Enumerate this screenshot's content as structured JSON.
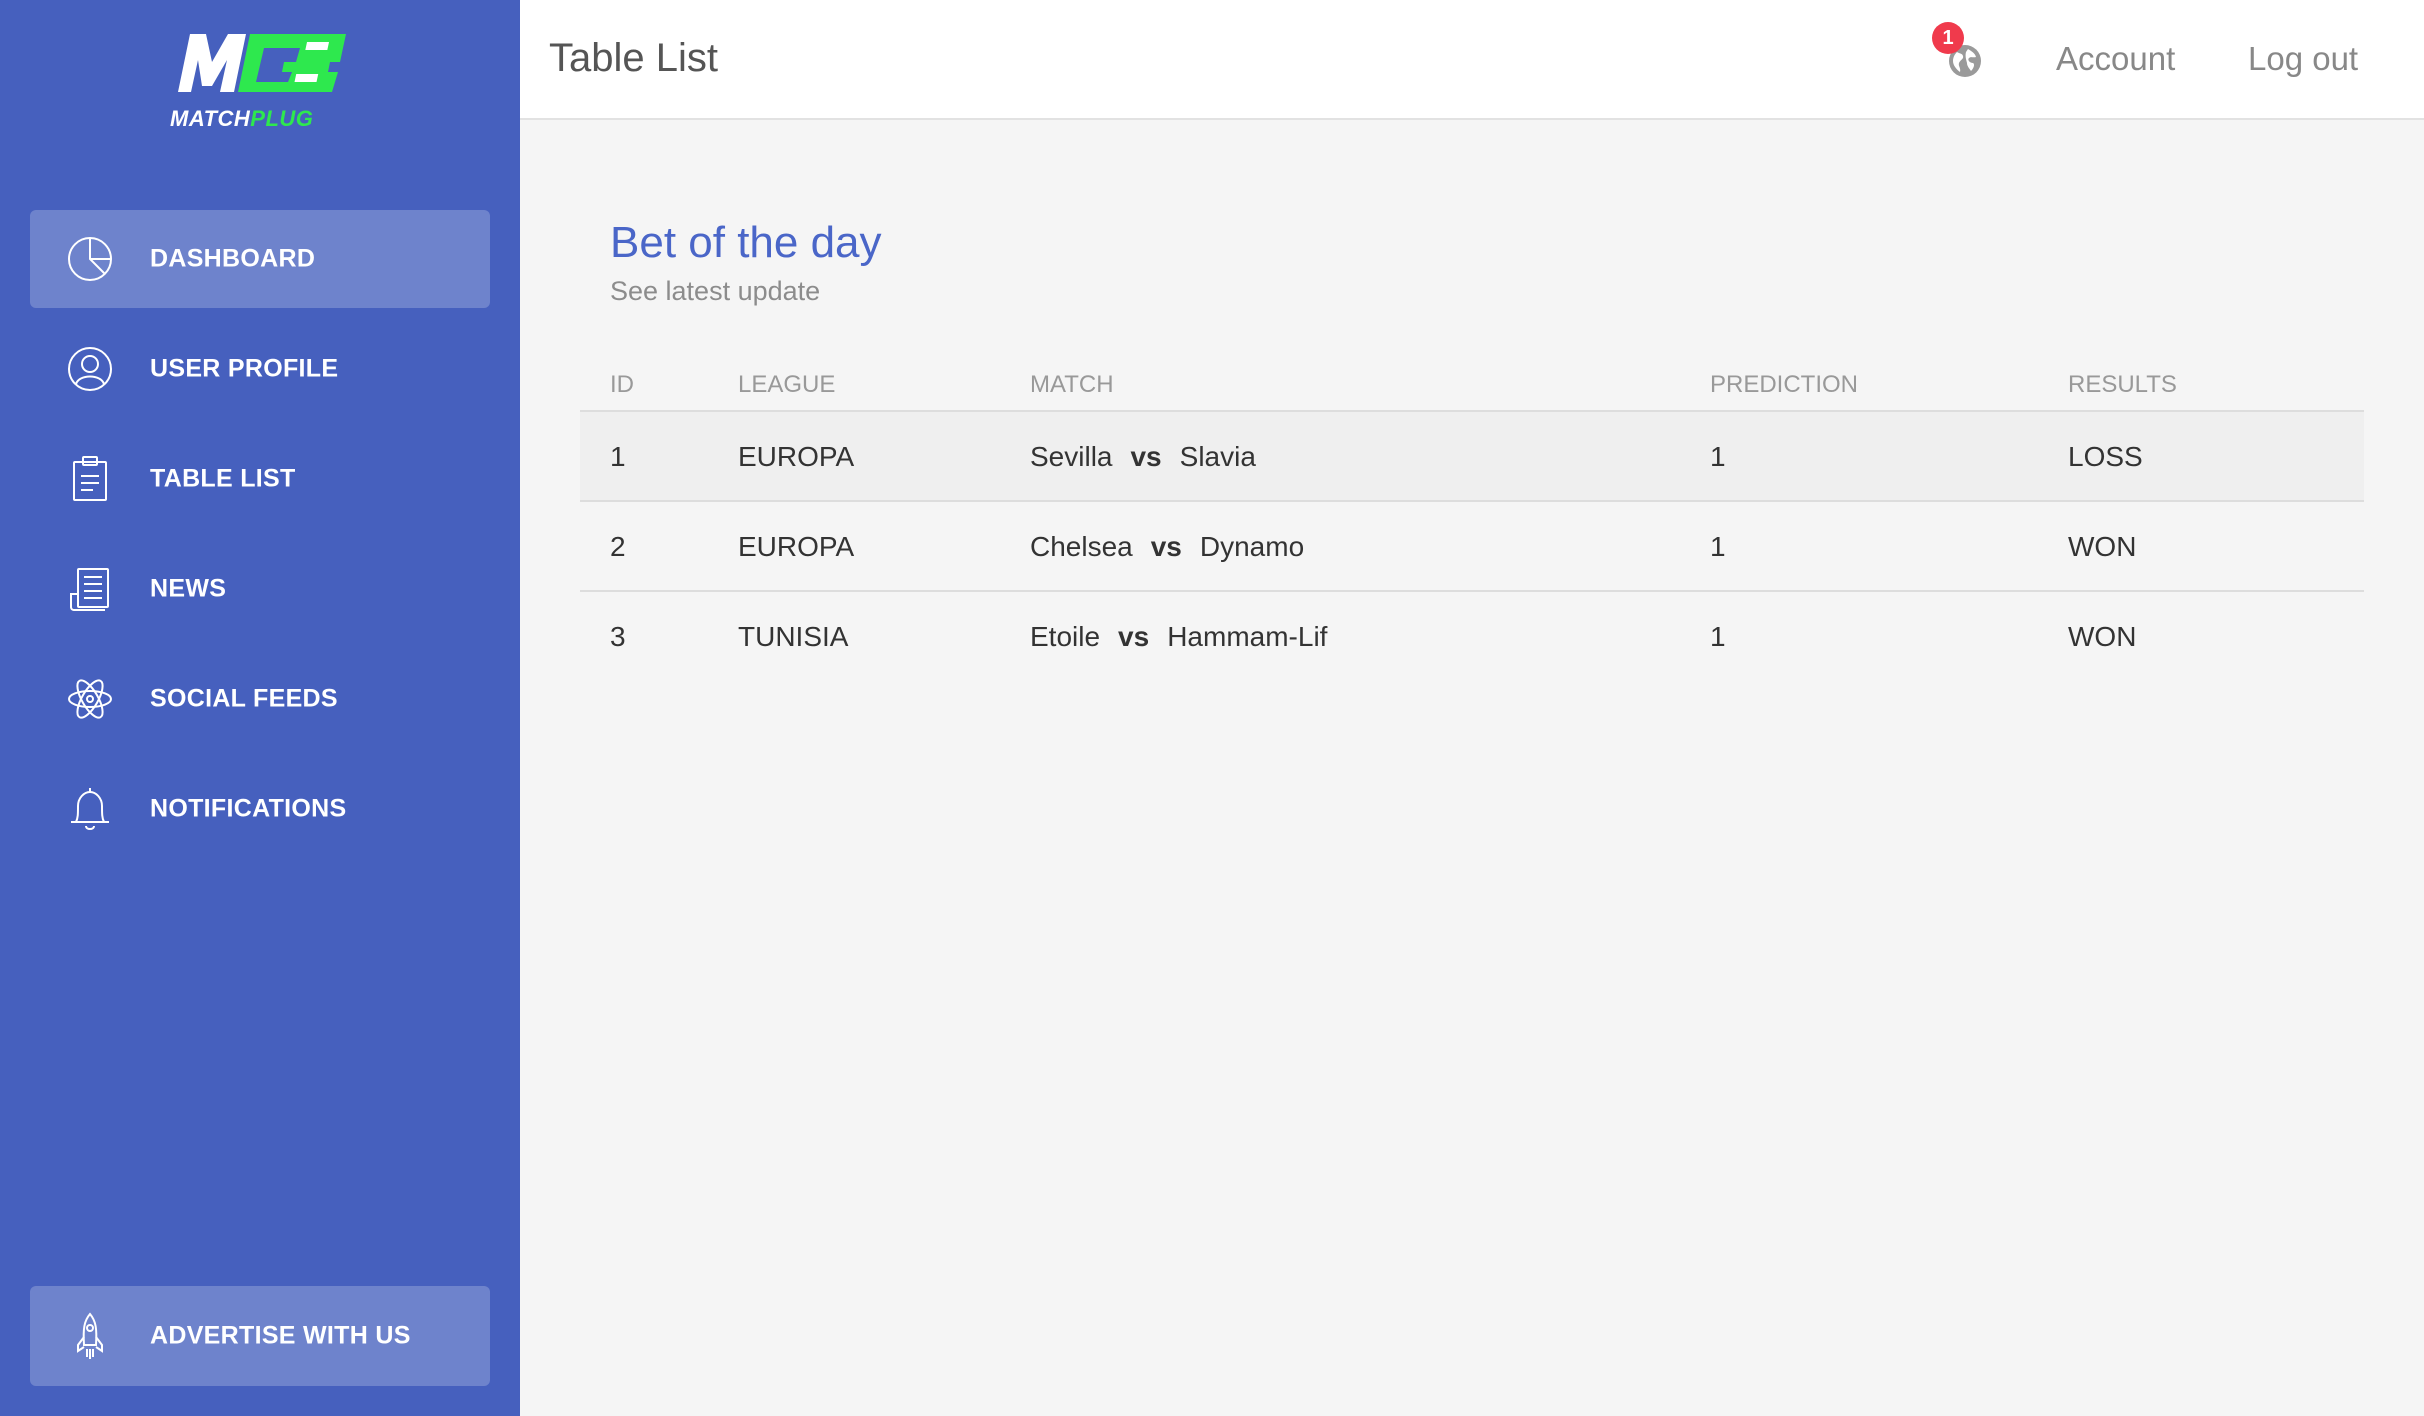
{
  "brand": {
    "mark": "M",
    "name_part1": "MATCH",
    "name_part2": "PLUG",
    "colors": {
      "sidebar": "#4660be",
      "accent_green": "#2ee84e",
      "title_blue": "#4a66c8",
      "badge_red": "#f03a4c"
    }
  },
  "sidebar": {
    "items": [
      {
        "label": "DASHBOARD",
        "icon": "pie-chart-icon",
        "active": true
      },
      {
        "label": "USER PROFILE",
        "icon": "user-icon",
        "active": false
      },
      {
        "label": "TABLE LIST",
        "icon": "clipboard-icon",
        "active": false
      },
      {
        "label": "NEWS",
        "icon": "newspaper-icon",
        "active": false
      },
      {
        "label": "SOCIAL FEEDS",
        "icon": "atom-icon",
        "active": false
      },
      {
        "label": "NOTIFICATIONS",
        "icon": "bell-icon",
        "active": false
      }
    ],
    "advertise": {
      "label": "ADVERTISE WITH US",
      "icon": "rocket-icon"
    }
  },
  "header": {
    "title": "Table List",
    "notification_count": "1",
    "notification_icon": "globe-icon",
    "account_label": "Account",
    "logout_label": "Log out"
  },
  "main": {
    "title": "Bet of the day",
    "subtitle": "See latest update",
    "table": {
      "columns": [
        "ID",
        "LEAGUE",
        "MATCH",
        "PREDICTION",
        "RESULTS"
      ],
      "vs_label": "vs",
      "rows": [
        {
          "id": "1",
          "league": "EUROPA",
          "home": "Sevilla",
          "away": "Slavia",
          "prediction": "1",
          "result": "LOSS"
        },
        {
          "id": "2",
          "league": "EUROPA",
          "home": "Chelsea",
          "away": "Dynamo",
          "prediction": "1",
          "result": "WON"
        },
        {
          "id": "3",
          "league": "TUNISIA",
          "home": "Etoile",
          "away": "Hammam-Lif",
          "prediction": "1",
          "result": "WON"
        }
      ]
    }
  }
}
